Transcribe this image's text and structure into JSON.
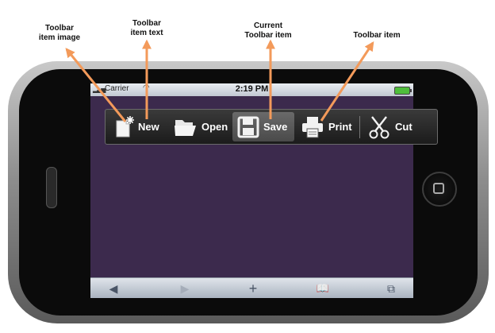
{
  "annotations": {
    "item_image": "Toolbar\nitem image",
    "item_text": "Toolbar\nitem text",
    "current_item": "Current\nToolbar item",
    "toolbar_item": "Toolbar item"
  },
  "status_bar": {
    "carrier": "Carrier",
    "time": "2:19 PM"
  },
  "toolbar": {
    "items": [
      {
        "label": "New",
        "icon": "new-document-icon",
        "current": false
      },
      {
        "label": "Open",
        "icon": "folder-icon",
        "current": false
      },
      {
        "label": "Save",
        "icon": "floppy-disk-icon",
        "current": true
      },
      {
        "label": "Print",
        "icon": "printer-icon",
        "current": false
      },
      {
        "label": "Cut",
        "icon": "scissors-icon",
        "current": false
      }
    ]
  },
  "browser_bar": {
    "back": "◀",
    "forward": "▶",
    "add": "+",
    "bookmarks": "📖",
    "pages": "⧉"
  },
  "colors": {
    "screen_background": "#3c2a4d",
    "toolbar_background": "#262626",
    "arrow": "#f39a5a"
  }
}
